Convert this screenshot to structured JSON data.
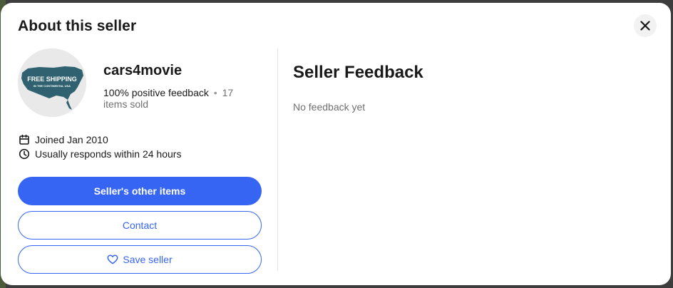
{
  "modal": {
    "title": "About this seller",
    "close_icon": "close-icon"
  },
  "seller": {
    "name": "cars4movie",
    "positive_feedback": "100% positive feedback",
    "separator": "•",
    "items_sold": "17 items sold",
    "joined": "Joined Jan 2010",
    "response_time": "Usually responds within 24 hours",
    "avatar_text_line1": "FREE SHIPPING",
    "avatar_text_line2": "IN THE CONTINENTAL USA"
  },
  "actions": {
    "other_items_label": "Seller's other items",
    "contact_label": "Contact",
    "save_label": "Save seller"
  },
  "feedback": {
    "title": "Seller Feedback",
    "empty_text": "No feedback yet"
  },
  "colors": {
    "accent": "#3665f3",
    "text": "#191919",
    "muted": "#707070"
  }
}
